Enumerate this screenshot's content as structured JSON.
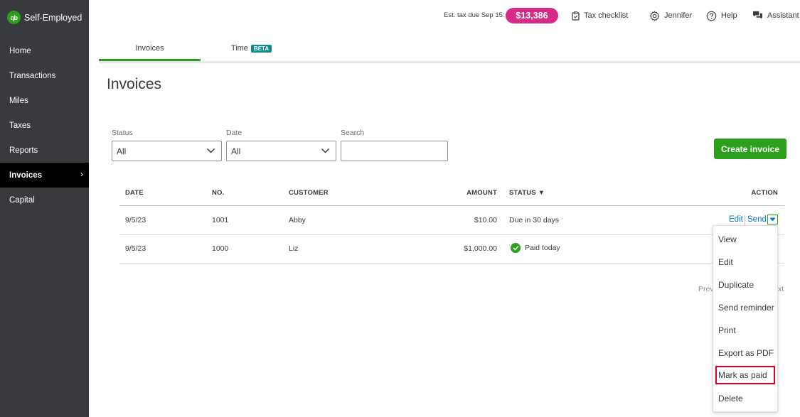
{
  "app": {
    "brand": "Self-Employed",
    "logo_text": "qb"
  },
  "sidebar": {
    "items": [
      {
        "label": "Home"
      },
      {
        "label": "Transactions"
      },
      {
        "label": "Miles"
      },
      {
        "label": "Taxes"
      },
      {
        "label": "Reports"
      },
      {
        "label": "Invoices",
        "active": true
      },
      {
        "label": "Capital"
      }
    ],
    "chevron": "›"
  },
  "topbar": {
    "est_tax_label": "Est. tax due Sep 15:",
    "est_tax_amount": "$13,386",
    "tax_checklist": "Tax checklist",
    "user": "Jennifer",
    "help": "Help",
    "assistant": "Assistant"
  },
  "tabs": [
    {
      "label": "Invoices",
      "active": true
    },
    {
      "label": "Time",
      "badge": "BETA"
    }
  ],
  "page": {
    "title": "Invoices"
  },
  "filters": {
    "status": {
      "label": "Status",
      "value": "All"
    },
    "date": {
      "label": "Date",
      "value": "All"
    },
    "search": {
      "label": "Search",
      "value": ""
    }
  },
  "create_button": "Create invoice",
  "table": {
    "headers": {
      "date": "DATE",
      "no": "NO.",
      "customer": "CUSTOMER",
      "amount": "AMOUNT",
      "status": "STATUS ▼",
      "action": "ACTION"
    },
    "rows": [
      {
        "date": "9/5/23",
        "no": "1001",
        "customer": "Abby",
        "amount": "$10.00",
        "status": "Due in 30 days"
      },
      {
        "date": "9/5/23",
        "no": "1000",
        "customer": "Liz",
        "amount": "$1,000.00",
        "status": "Paid today"
      }
    ],
    "row_actions": {
      "edit": "Edit",
      "send": "Send"
    }
  },
  "pager": {
    "prev": "Prev",
    "next": "xt"
  },
  "action_menu": {
    "items": [
      "View",
      "Edit",
      "Duplicate",
      "Send reminder",
      "Print",
      "Export as PDF",
      "Mark as paid",
      "Delete"
    ],
    "highlighted": "Mark as paid"
  },
  "colors": {
    "accent_green": "#2ca01c",
    "tax_pink": "#d52b87",
    "link_blue": "#0077c5",
    "sidebar_bg": "#393a3d",
    "beta_teal": "#0d8a8b",
    "highlight_red": "#e0001b"
  }
}
